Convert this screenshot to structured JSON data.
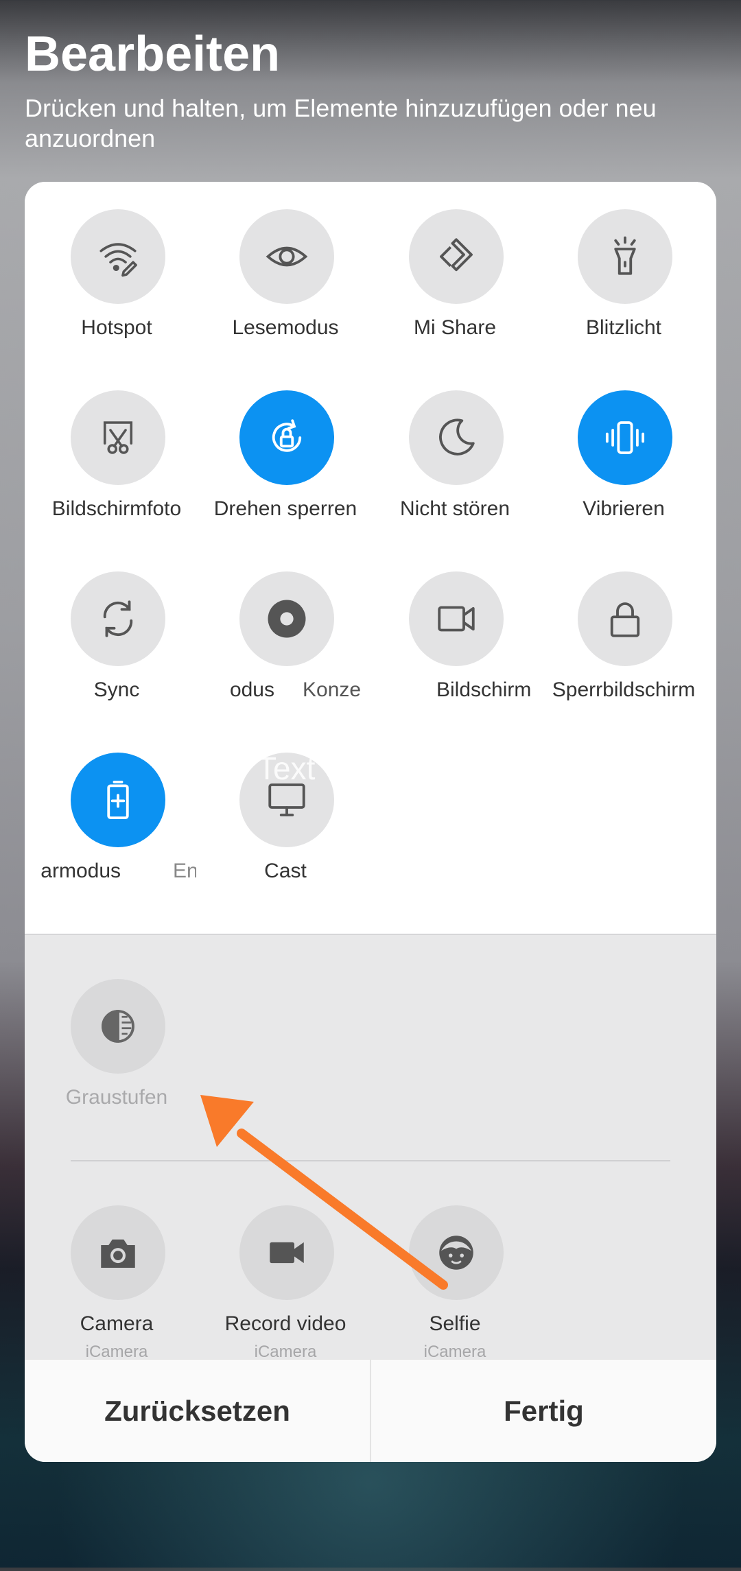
{
  "header": {
    "title": "Bearbeiten",
    "subtitle": "Drücken und halten, um Elemente hinzuzufügen oder neu anzuordnen"
  },
  "active_tiles": [
    {
      "label": "Hotspot",
      "icon": "hotspot-icon",
      "on": false
    },
    {
      "label": "Lesemodus",
      "icon": "eye-icon",
      "on": false
    },
    {
      "label": "Mi Share",
      "icon": "mi-share-icon",
      "on": false
    },
    {
      "label": "Blitzlicht",
      "icon": "flashlight-icon",
      "on": false
    },
    {
      "label": "Bildschirmfoto",
      "icon": "screenshot-icon",
      "on": false
    },
    {
      "label": "Drehen sperren",
      "icon": "rotation-lock-icon",
      "on": true
    },
    {
      "label": "Nicht stören",
      "icon": "moon-icon",
      "on": false
    },
    {
      "label": "Vibrieren",
      "icon": "vibrate-icon",
      "on": true
    },
    {
      "label": "Sync",
      "icon": "sync-icon",
      "on": false
    },
    {
      "label": "odus",
      "icon": "record-icon",
      "on": false
    },
    {
      "label": "Bildschirm",
      "icon": "video-camera-icon",
      "on": false
    },
    {
      "label": "Sperrbildschirm",
      "icon": "lock-icon",
      "on": false
    },
    {
      "label": "armodus",
      "icon": "battery-saver-icon",
      "on": true
    },
    {
      "label": "Cast",
      "icon": "cast-icon",
      "on": false
    }
  ],
  "ghost_labels": {
    "konze": "Konze",
    "en": "En",
    "text": "Text"
  },
  "inactive_tiles": [
    {
      "label": "Graustufen",
      "icon": "grayscale-icon"
    }
  ],
  "shortcut_tiles": [
    {
      "label": "Camera",
      "sublabel": "iCamera",
      "icon": "camera-icon"
    },
    {
      "label": "Record video",
      "sublabel": "iCamera",
      "icon": "record-video-icon"
    },
    {
      "label": "Selfie",
      "sublabel": "iCamera",
      "icon": "selfie-icon"
    }
  ],
  "footer": {
    "reset_label": "Zurücksetzen",
    "done_label": "Fertig"
  },
  "colors": {
    "accent": "#0c92f2",
    "arrow": "#f97a2a",
    "tile_off": "#e3e3e4"
  }
}
